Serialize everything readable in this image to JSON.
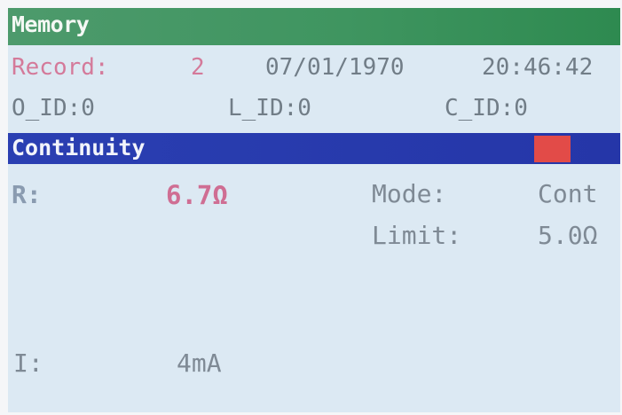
{
  "header": {
    "title": "Memory",
    "title_color": "#3f9560"
  },
  "record": {
    "label": "Record:",
    "number": "2",
    "date": "07/01/1970",
    "time": "20:46:42"
  },
  "ids": {
    "o_id": "O_ID:0",
    "l_id": "L_ID:0",
    "c_id": "C_ID:0"
  },
  "section": {
    "title": "Continuity",
    "bar_color": "#2a3fb2",
    "indicator_color": "#e24b48",
    "indicator_icon": "status-square-icon"
  },
  "measurement": {
    "resistance_label": "R:",
    "resistance_value": "6.7Ω",
    "mode_label": "Mode:",
    "mode_value": "Cont",
    "limit_label": "Limit:",
    "limit_value": "5.0Ω",
    "current_label": "I:",
    "current_value": "4mA"
  }
}
